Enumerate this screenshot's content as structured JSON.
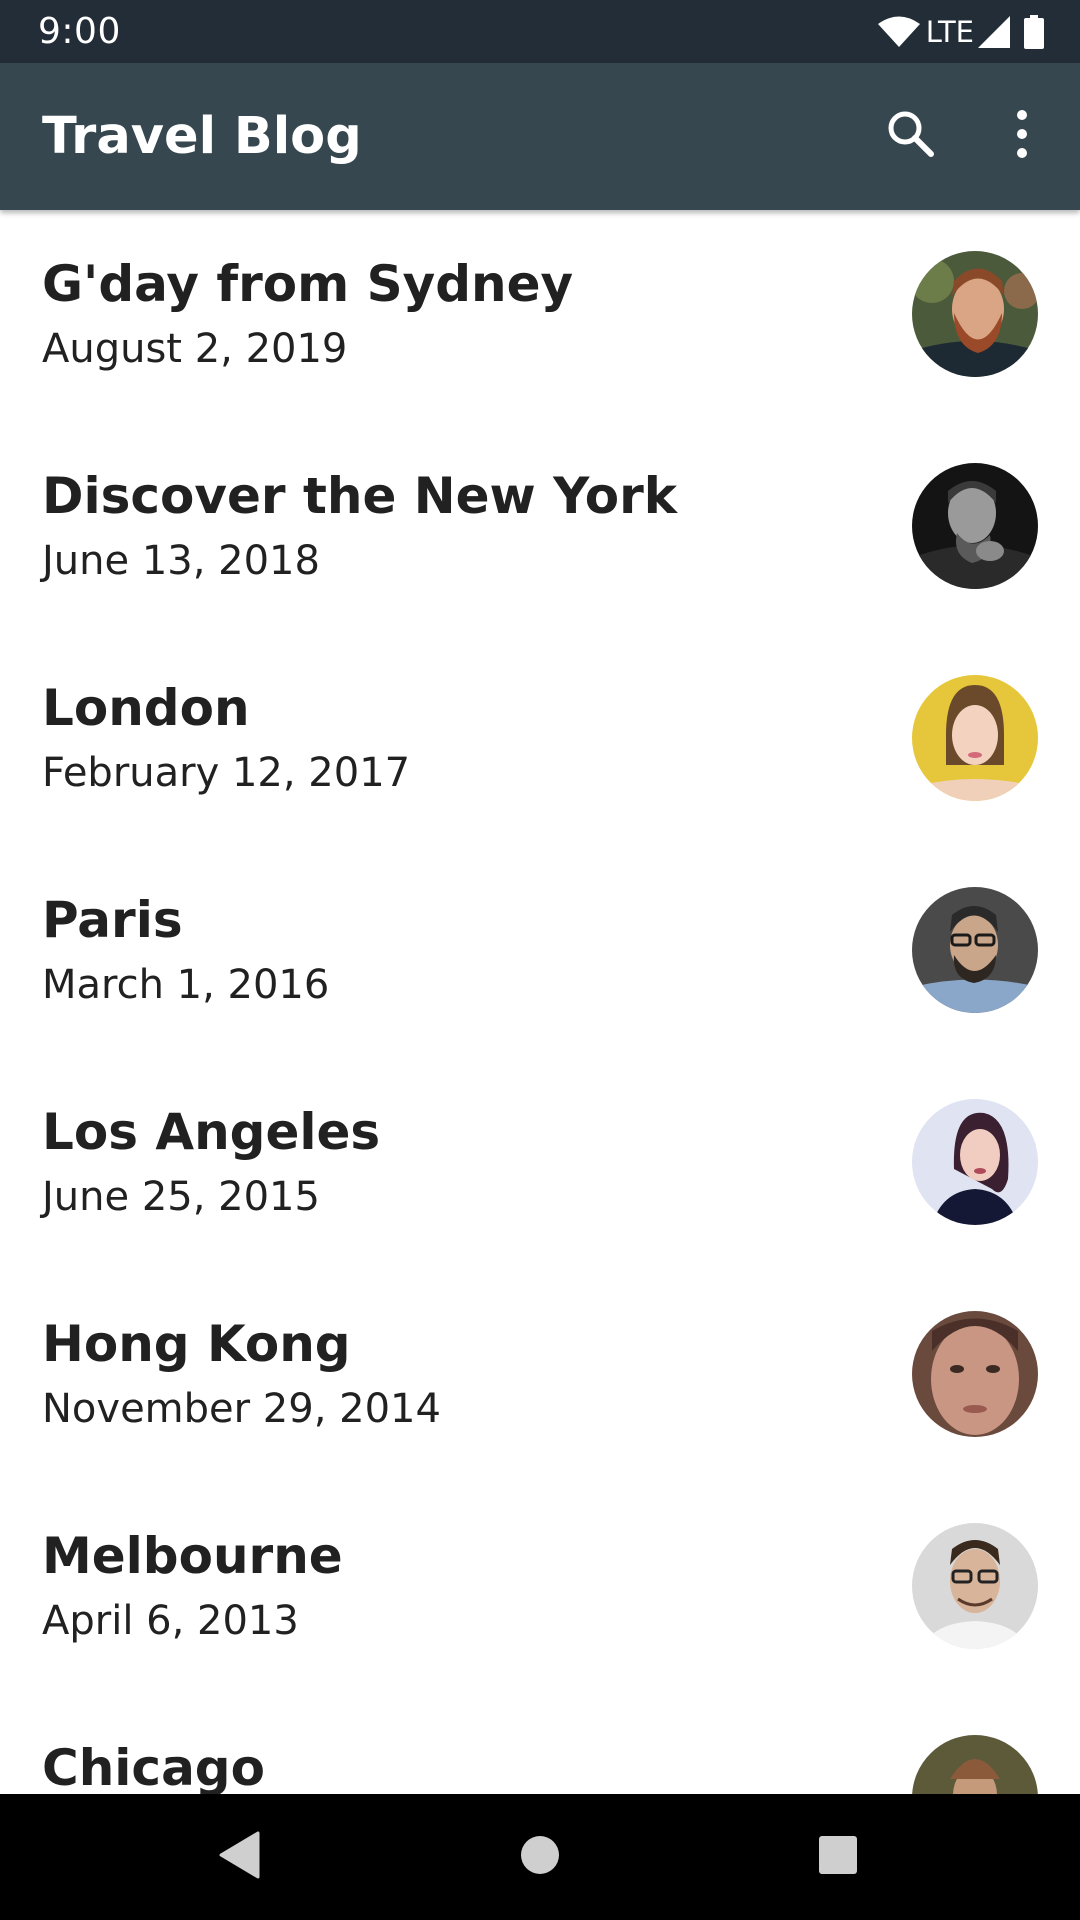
{
  "status_bar": {
    "time": "9:00",
    "network": "LTE",
    "icons": [
      "wifi-icon",
      "cellular-signal-icon",
      "battery-icon"
    ]
  },
  "app_bar": {
    "title": "Travel Blog",
    "actions": [
      "search-icon",
      "more-vert-icon"
    ]
  },
  "posts": [
    {
      "title": "G'day from Sydney",
      "date": "August 2, 2019",
      "avatar": "bearded-man-red-hair-avatar",
      "avatar_bg": "#4a5a3a"
    },
    {
      "title": "Discover the New York",
      "date": "June 13, 2018",
      "avatar": "man-black-and-white-avatar",
      "avatar_bg": "#1a1a1a"
    },
    {
      "title": "London",
      "date": "February 12, 2017",
      "avatar": "woman-yellow-background-avatar",
      "avatar_bg": "#e6c63a"
    },
    {
      "title": "Paris",
      "date": "March 1, 2016",
      "avatar": "man-glasses-beard-avatar",
      "avatar_bg": "#4a4a4a"
    },
    {
      "title": "Los Angeles",
      "date": "June 25, 2015",
      "avatar": "woman-dark-hair-avatar",
      "avatar_bg": "#dfe3f2"
    },
    {
      "title": "Hong Kong",
      "date": "November 29, 2014",
      "avatar": "young-man-closeup-avatar",
      "avatar_bg": "#6b4a3e"
    },
    {
      "title": "Melbourne",
      "date": "April 6, 2013",
      "avatar": "man-glasses-smiling-avatar",
      "avatar_bg": "#d9d9d9"
    },
    {
      "title": "Chicago",
      "date": "",
      "avatar": "man-beanie-outdoor-avatar",
      "avatar_bg": "#5d5a3a"
    }
  ],
  "navigation_bar": {
    "buttons": [
      "back-icon",
      "home-icon",
      "recents-icon"
    ]
  },
  "colors": {
    "status_bar": "#232d37",
    "app_bar": "#37474f",
    "text_primary": "#212121",
    "background": "#ffffff",
    "nav_bar": "#000000",
    "nav_icons": "#cfcfcf"
  }
}
